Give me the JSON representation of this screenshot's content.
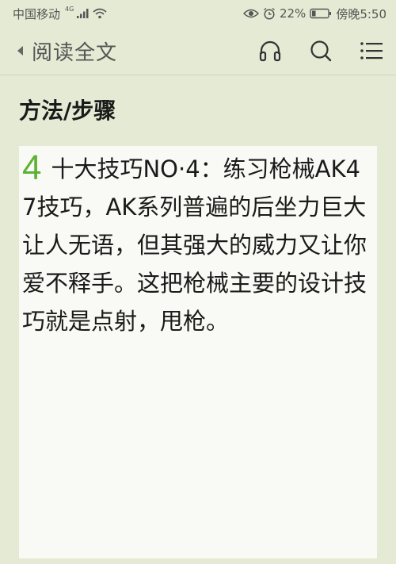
{
  "status_bar": {
    "carrier": "中国移动",
    "network": "4G",
    "battery_percent": "22%",
    "time": "傍晚5:50"
  },
  "nav": {
    "back_icon": "chevron-left-icon",
    "title": "阅读全文",
    "actions": [
      "headphones-icon",
      "search-icon",
      "menu-icon"
    ]
  },
  "section": {
    "heading": "方法/步骤"
  },
  "step": {
    "number": "4",
    "text": "十大技巧NO·4：练习枪械AK47技巧，AK系列普遍的后坐力巨大让人无语，但其强大的威力又让你爱不释手。这把枪械主要的设计技巧就是点射，甩枪。"
  },
  "colors": {
    "background": "#e4ead4",
    "card": "#f9faf5",
    "accent": "#5db135"
  }
}
